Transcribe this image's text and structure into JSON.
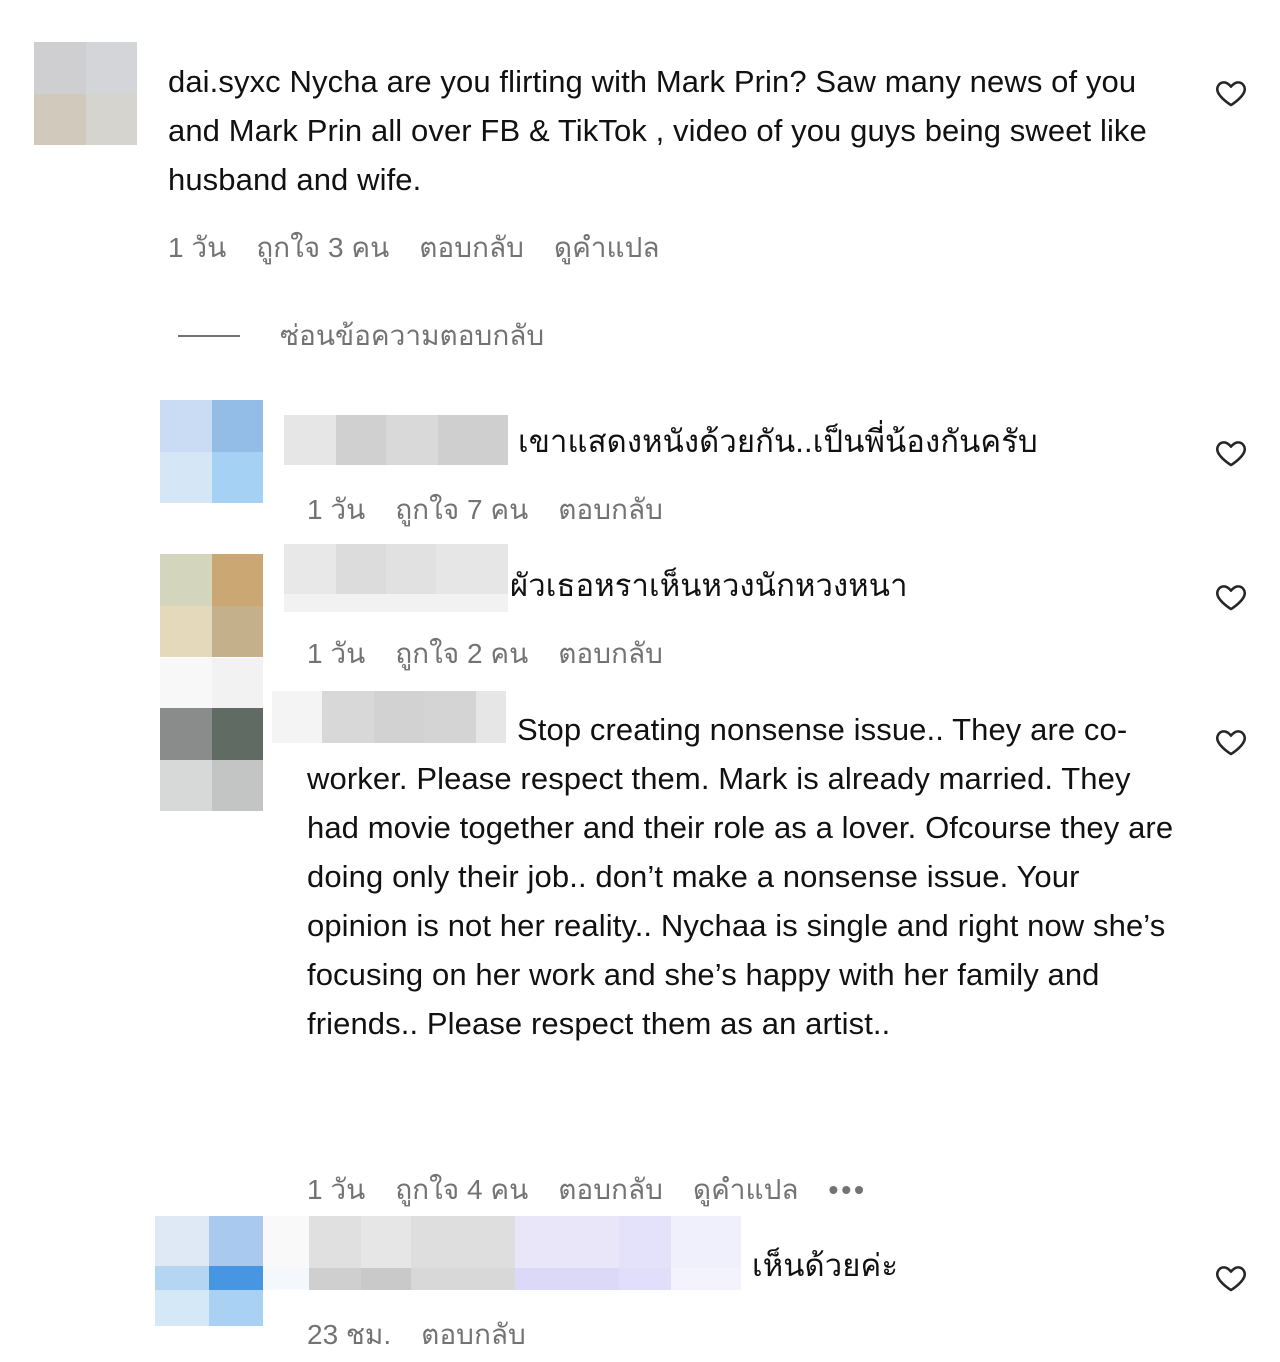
{
  "comment": {
    "username": "dai.syxc",
    "text": "Nycha are you flirting with Mark Prin? Saw many news of you and Mark Prin all over FB & TikTok , video of you guys being sweet like husband and wife.",
    "time": "1 วัน",
    "likes": "ถูกใจ 3 คน",
    "reply_label": "ตอบกลับ",
    "translate_label": "ดูคำแปล",
    "heart_icon": "heart-outline-icon"
  },
  "hide_replies_label": "ซ่อนข้อความตอบกลับ",
  "replies": [
    {
      "text": "เขาแสดงหนังด้วยกัน..เป็นพี่น้องกันครับ",
      "time": "1 วัน",
      "likes": "ถูกใจ 7 คน",
      "reply_label": "ตอบกลับ"
    },
    {
      "text": "ผัวเธอหราเห็นหวงนักหวงหนา",
      "time": "1 วัน",
      "likes": "ถูกใจ 2 คน",
      "reply_label": "ตอบกลับ"
    },
    {
      "text": "Stop creating nonsense issue.. They are co-worker. Please respect them. Mark is already married. They had movie together and their role as a lover. Ofcourse they are doing only their job.. don’t make a nonsense issue. Your opinion is not her reality.. Nychaa is single and right now she’s focusing on her work and she’s happy with her family and friends.. Please respect them as an artist..",
      "time": "1 วัน",
      "likes": "ถูกใจ 4 คน",
      "reply_label": "ตอบกลับ",
      "translate_label": "ดูคำแปล",
      "more_label": "•••"
    },
    {
      "text": "เห็นด้วยค่ะ",
      "time": "23 ชม.",
      "reply_label": "ตอบกลับ"
    }
  ]
}
